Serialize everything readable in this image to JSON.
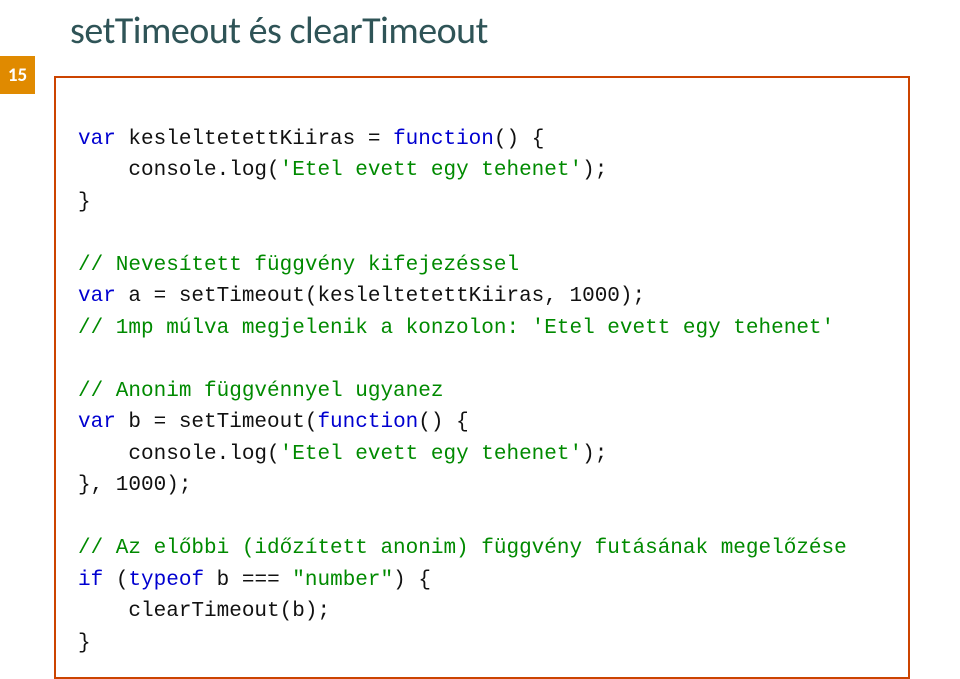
{
  "slide": {
    "number": "15",
    "title": "setTimeout és clearTimeout"
  },
  "code": {
    "l1a": "var",
    "l1b": " kesleltetettKiiras = ",
    "l1c": "function",
    "l1d": "() {",
    "l2a": "    console.log(",
    "l2b": "'Etel evett egy tehenet'",
    "l2c": ");",
    "l3": "}",
    "l5": "// Nevesített függvény kifejezéssel",
    "l6a": "var",
    "l6b": " a = setTimeout(kesleltetettKiiras, 1000);",
    "l7": "// 1mp múlva megjelenik a konzolon: 'Etel evett egy tehenet'",
    "l9": "// Anonim függvénnyel ugyanez",
    "l10a": "var",
    "l10b": " b = setTimeout(",
    "l10c": "function",
    "l10d": "() {",
    "l11a": "    console.log(",
    "l11b": "'Etel evett egy tehenet'",
    "l11c": ");",
    "l12": "}, 1000);",
    "l14": "// Az előbbi (időzített anonim) függvény futásának megelőzése",
    "l15a": "if",
    "l15b": " (",
    "l15c": "typeof",
    "l15d": " b === ",
    "l15e": "\"number\"",
    "l15f": ") {",
    "l16": "    clearTimeout(b);",
    "l17": "}"
  }
}
